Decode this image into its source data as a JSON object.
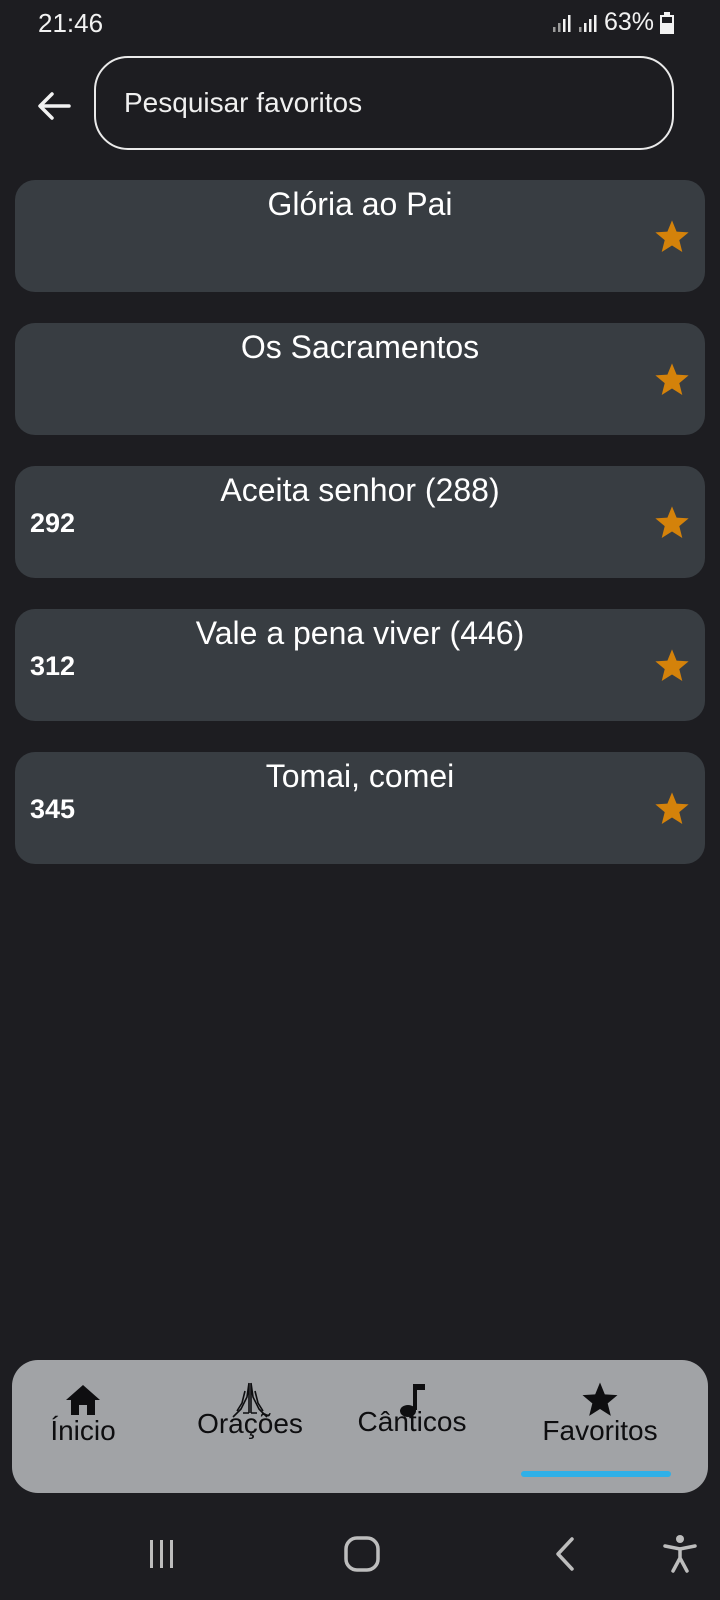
{
  "status_bar": {
    "time": "21:46",
    "battery": "63%",
    "icons": [
      "signal-icon",
      "signal-icon",
      "battery-icon"
    ]
  },
  "header": {
    "back_icon": "arrow-left-icon",
    "search_placeholder": "Pesquisar favoritos",
    "search_value": ""
  },
  "favorites": [
    {
      "title": "Glória ao Pai",
      "number": ""
    },
    {
      "title": "Os Sacramentos",
      "number": ""
    },
    {
      "title": "Aceita senhor (288)",
      "number": "292"
    },
    {
      "title": "Vale a pena viver (446)",
      "number": "312"
    },
    {
      "title": "Tomai, comei",
      "number": "345"
    }
  ],
  "star_color": "#d4820a",
  "bottom_nav": {
    "items": [
      {
        "label": "Ínicio",
        "icon": "home-icon"
      },
      {
        "label": "Orações",
        "icon": "praying-hands-icon"
      },
      {
        "label": "Cânticos",
        "icon": "music-note-icon"
      },
      {
        "label": "Favoritos",
        "icon": "star-icon"
      }
    ],
    "active": "Favoritos",
    "indicator_color": "#2fb0e8"
  },
  "system_nav": {
    "icons": [
      "recent-apps-icon",
      "home-circle-icon",
      "back-chevron-icon",
      "accessibility-icon"
    ]
  }
}
